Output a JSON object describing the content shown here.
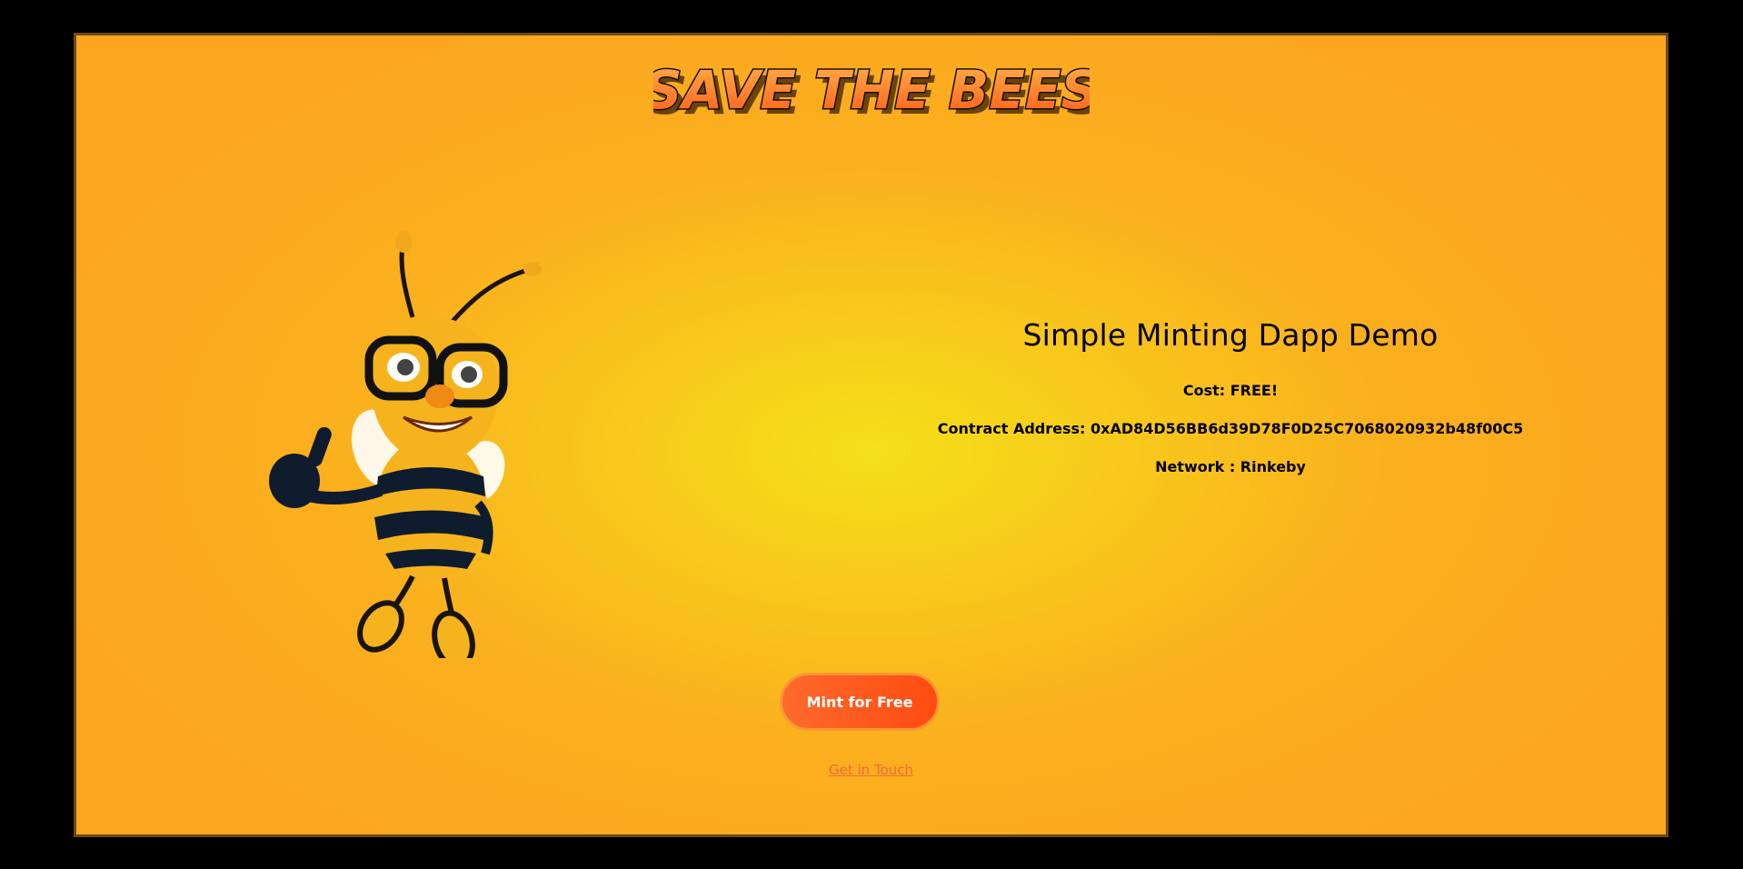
{
  "header": {
    "logo_text": "SAVE THE BEES"
  },
  "mascot": {
    "icon": "bee-mascot-icon"
  },
  "info": {
    "title": "Simple Minting Dapp Demo",
    "cost": "Cost: FREE!",
    "contract": "Contract Address: 0xAD84D56BB6d39D78F0D25C7068020932b48f00C5",
    "network": "Network : Rinkeby"
  },
  "actions": {
    "mint_label": "Mint for Free",
    "contact_label": "Get in Touch"
  },
  "colors": {
    "page_background": "#000000",
    "panel_gradient_center": "#f4e01a",
    "panel_gradient_edge": "#fca620",
    "mint_button": "#ff5a1e",
    "contact_link": "#f26a3c",
    "logo_fill": "#ff7a2a"
  }
}
